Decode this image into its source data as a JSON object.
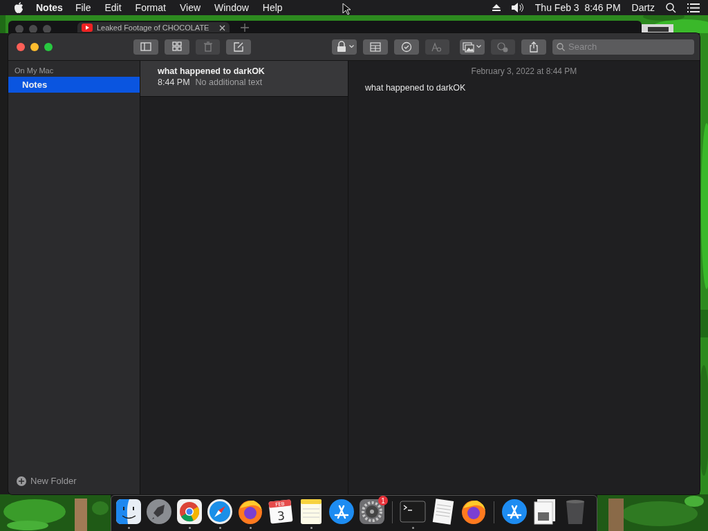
{
  "menubar": {
    "app_name": "Notes",
    "menus": [
      "File",
      "Edit",
      "Format",
      "View",
      "Window",
      "Help"
    ],
    "clock": "Thu Feb 3  8:46 PM",
    "user": "Dartz"
  },
  "browser_window": {
    "tab_title": "Leaked Footage of CHOCOLATE"
  },
  "notes_window": {
    "toolbar": [
      {
        "kind": "sidebar",
        "disabled": false
      },
      {
        "kind": "gallery",
        "disabled": false
      },
      {
        "kind": "trash",
        "disabled": true
      },
      {
        "kind": "compose",
        "disabled": false
      },
      {
        "kind": "lock",
        "disabled": false
      },
      {
        "kind": "table",
        "disabled": false
      },
      {
        "kind": "checklist",
        "disabled": false
      },
      {
        "kind": "format",
        "disabled": true
      },
      {
        "kind": "media",
        "disabled": false
      },
      {
        "kind": "collaborate",
        "disabled": true
      },
      {
        "kind": "share",
        "disabled": false
      }
    ],
    "search": {
      "placeholder": "Search"
    },
    "sidebar": {
      "section": "On My Mac",
      "folders": [
        {
          "label": "Notes",
          "selected": true
        }
      ],
      "new_folder": "New Folder"
    },
    "notes": [
      {
        "title": "what happened to darkOK",
        "time": "8:44 PM",
        "preview": "No additional text",
        "selected": true
      }
    ],
    "editor": {
      "date": "February 3, 2022 at 8:44 PM",
      "body": "what happened to darkOK"
    }
  },
  "dock": [
    {
      "kind": "finder",
      "running": true
    },
    {
      "kind": "launchpad",
      "running": false
    },
    {
      "kind": "chrome",
      "running": true
    },
    {
      "kind": "safari",
      "running": true
    },
    {
      "kind": "firefox",
      "running": true
    },
    {
      "kind": "calendar",
      "running": false,
      "month": "FEB",
      "day": "3"
    },
    {
      "kind": "notes",
      "running": true
    },
    {
      "kind": "appstore",
      "running": false
    },
    {
      "kind": "settings",
      "running": false,
      "badge": "1"
    },
    {
      "kind": "separator"
    },
    {
      "kind": "terminal",
      "running": true
    },
    {
      "kind": "textedit",
      "running": false
    },
    {
      "kind": "firefox",
      "running": false
    },
    {
      "kind": "separator"
    },
    {
      "kind": "appstore",
      "running": false
    },
    {
      "kind": "document",
      "running": false
    },
    {
      "kind": "trash",
      "running": false
    }
  ]
}
